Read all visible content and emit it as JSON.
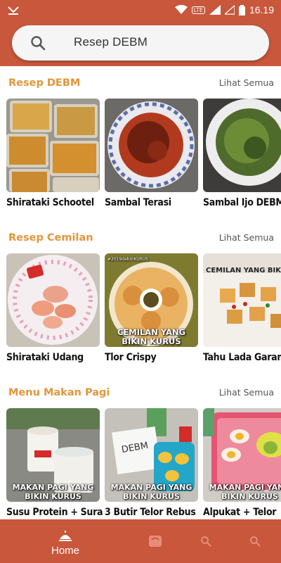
{
  "status_bar": {
    "time": "16.19",
    "network": "LTE"
  },
  "search": {
    "value": "Resep DEBM"
  },
  "sections": [
    {
      "title": "Resep DEBM",
      "link": "Lihat Semua",
      "items": [
        {
          "label": "Shirataki Schootel"
        },
        {
          "label": "Sambal Terasi"
        },
        {
          "label": "Sambal Ijo DEBM"
        }
      ]
    },
    {
      "title": "Resep Cemilan",
      "link": "Lihat Semua",
      "items": [
        {
          "label": "Shirataki Udang"
        },
        {
          "label": "Tlor Crispy",
          "overlay": "CEMILAN YANG BIKIN KURUS",
          "tag": "#2019debmKURUS"
        },
        {
          "label": "Tahu Lada Garam",
          "overlay": "CEMILAN YANG BIKIN KURUS"
        }
      ]
    },
    {
      "title": "Menu Makan Pagi",
      "link": "Lihat Semua",
      "items": [
        {
          "label": "Susu Protein + Sura",
          "overlay": "MAKAN PAGI YANG BIKIN KURUS"
        },
        {
          "label": "3 Butir Telor Rebus",
          "overlay": "MAKAN PAGI YANG BIKIN KURUS",
          "sign": "DEBM"
        },
        {
          "label": "Alpukat + Telor",
          "overlay": "MAKAN PAGI YANG BIKIN KURUS"
        }
      ]
    }
  ],
  "bottom_nav": {
    "home_label": "Home"
  },
  "colors": {
    "primary": "#c8573b",
    "section_title": "#e2963a"
  }
}
